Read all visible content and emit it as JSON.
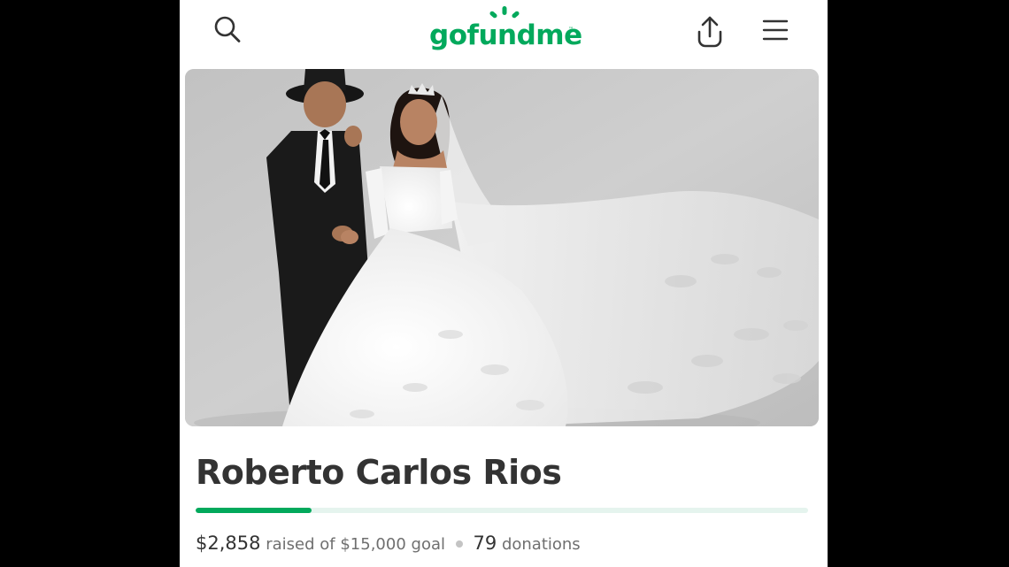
{
  "header": {
    "logo_text": "gofundme",
    "logo_tm": "™",
    "icons": [
      "search-icon",
      "share-icon",
      "menu-icon"
    ],
    "brand_color": "#02a95c"
  },
  "hero": {
    "image": "wedding-couple-photo"
  },
  "campaign": {
    "title": "Roberto Carlos Rios",
    "raised": "$2,858",
    "raised_text": "raised of",
    "goal": "$15,000",
    "goal_text": "goal",
    "donations_count": "79",
    "donations_text": "donations",
    "progress_fraction": 0.19
  }
}
